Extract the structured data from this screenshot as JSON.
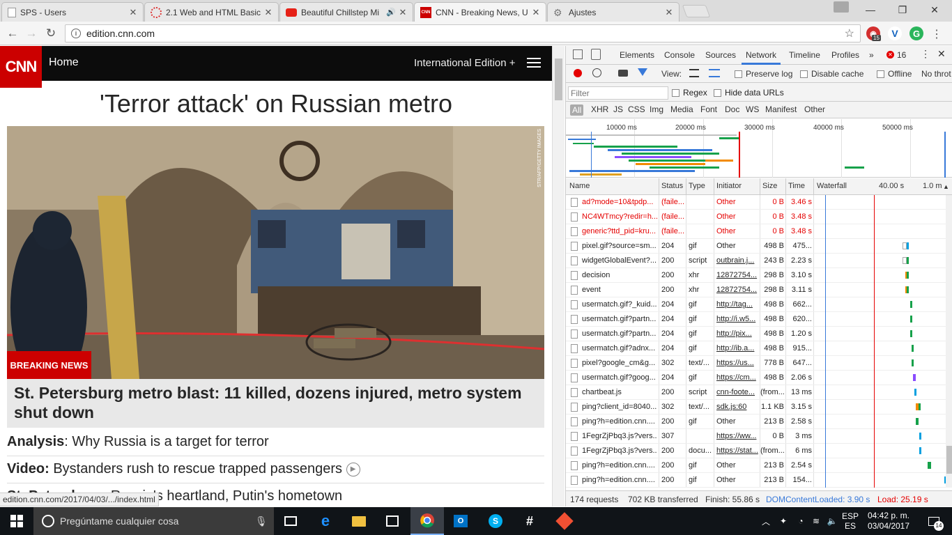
{
  "browser": {
    "tabs": [
      {
        "title": "SPS - Users",
        "favicon": "page-icon"
      },
      {
        "title": "2.1 Web and HTML Basic",
        "favicon": "loading-icon"
      },
      {
        "title": "Beautiful Chillstep Mi",
        "favicon": "youtube-icon"
      },
      {
        "title": "CNN - Breaking News, U",
        "favicon": "cnn-icon"
      },
      {
        "title": "Ajustes",
        "favicon": "gear-icon"
      }
    ],
    "address": "edition.cnn.com",
    "extension_badge": "15",
    "status_url": "edition.cnn.com/2017/04/03/.../index.html"
  },
  "cnn": {
    "logo": "CNN",
    "home": "Home",
    "edition": "International Edition +",
    "headline": "'Terror attack' on Russian metro",
    "photo_credit": "STR/AFP/GETTY IMAGES",
    "breaking": "BREAKING NEWS",
    "main_story": "St. Petersburg metro blast: 11 killed, dozens injured, metro system shut down",
    "stories": [
      {
        "label": "Analysis",
        "sep": ":",
        "text": " Why Russia is a target for terror"
      },
      {
        "label": "Video:",
        "sep": "",
        "text": " Bystanders rush to rescue trapped passengers"
      },
      {
        "label": "St. Petersburg:",
        "sep": "",
        "text": " Russia's heartland, Putin's hometown"
      }
    ]
  },
  "devtools": {
    "tabs": [
      "Elements",
      "Console",
      "Sources",
      "Network",
      "Timeline",
      "Profiles"
    ],
    "more": "»",
    "error_count": "16",
    "controls": {
      "view": "View:",
      "preserve_log": "Preserve log",
      "disable_cache": "Disable cache",
      "offline": "Offline",
      "throttle": "No throt"
    },
    "filter_placeholder": "Filter",
    "regex": "Regex",
    "hide_data_urls": "Hide data URLs",
    "types": [
      "All",
      "XHR",
      "JS",
      "CSS",
      "Img",
      "Media",
      "Font",
      "Doc",
      "WS",
      "Manifest",
      "Other"
    ],
    "overview_labels": [
      "10000 ms",
      "20000 ms",
      "30000 ms",
      "40000 ms",
      "50000 ms"
    ],
    "columns": [
      "Name",
      "Status",
      "Type",
      "Initiator",
      "Size",
      "Time",
      "Waterfall",
      "40.00 s",
      "1.0 m"
    ],
    "rows": [
      {
        "name": "ad?mode=10&tpdp...",
        "status": "(faile...",
        "type": "",
        "initiator": "Other",
        "size": "0 B",
        "time": "3.46 s",
        "error": true,
        "link": false,
        "wf": [],
        "wfc": []
      },
      {
        "name": "NC4WTmcy?redir=h...",
        "status": "(faile...",
        "type": "",
        "initiator": "Other",
        "size": "0 B",
        "time": "3.48 s",
        "error": true,
        "link": false,
        "wf": [],
        "wfc": []
      },
      {
        "name": "generic?ttd_pid=kru...",
        "status": "(faile...",
        "type": "",
        "initiator": "Other",
        "size": "0 B",
        "time": "3.48 s",
        "error": true,
        "link": false,
        "wf": [],
        "wfc": []
      },
      {
        "name": "pixel.gif?source=sm...",
        "status": "204",
        "type": "gif",
        "initiator": "Other",
        "size": "498 B",
        "time": "475...",
        "error": false,
        "link": false,
        "wf": [
          [
            0.67,
            0.03
          ],
          [
            0.7,
            0.01
          ]
        ],
        "wfc": [
          "#ffffff",
          "#00a0e0"
        ]
      },
      {
        "name": "widgetGlobalEvent?...",
        "status": "200",
        "type": "script",
        "initiator": "outbrain.j...",
        "size": "243 B",
        "time": "2.23 s",
        "error": false,
        "link": true,
        "wf": [
          [
            0.67,
            0.03
          ],
          [
            0.7,
            0.02
          ]
        ],
        "wfc": [
          "#ffffff",
          "#16a14a"
        ]
      },
      {
        "name": "decision",
        "status": "200",
        "type": "xhr",
        "initiator": "12872754...",
        "size": "298 B",
        "time": "3.10 s",
        "error": false,
        "link": true,
        "wf": [
          [
            0.69,
            0.01
          ],
          [
            0.7,
            0.02
          ]
        ],
        "wfc": [
          "#f28b00",
          "#16a14a"
        ]
      },
      {
        "name": "event",
        "status": "200",
        "type": "xhr",
        "initiator": "12872754...",
        "size": "298 B",
        "time": "3.11 s",
        "error": false,
        "link": true,
        "wf": [
          [
            0.69,
            0.01
          ],
          [
            0.7,
            0.02
          ]
        ],
        "wfc": [
          "#f28b00",
          "#16a14a"
        ]
      },
      {
        "name": "usermatch.gif?_kuid...",
        "status": "204",
        "type": "gif",
        "initiator": "http://tag...",
        "size": "498 B",
        "time": "662...",
        "error": false,
        "link": true,
        "wf": [
          [
            0.73,
            0.01
          ]
        ],
        "wfc": [
          "#16a14a"
        ]
      },
      {
        "name": "usermatch.gif?partn...",
        "status": "204",
        "type": "gif",
        "initiator": "http://i.w5...",
        "size": "498 B",
        "time": "620...",
        "error": false,
        "link": true,
        "wf": [
          [
            0.73,
            0.01
          ]
        ],
        "wfc": [
          "#16a14a"
        ]
      },
      {
        "name": "usermatch.gif?partn...",
        "status": "204",
        "type": "gif",
        "initiator": "http://pix...",
        "size": "498 B",
        "time": "1.20 s",
        "error": false,
        "link": true,
        "wf": [
          [
            0.73,
            0.01
          ]
        ],
        "wfc": [
          "#16a14a"
        ]
      },
      {
        "name": "usermatch.gif?adnx...",
        "status": "204",
        "type": "gif",
        "initiator": "http://ib.a...",
        "size": "498 B",
        "time": "915...",
        "error": false,
        "link": true,
        "wf": [
          [
            0.74,
            0.01
          ]
        ],
        "wfc": [
          "#16a14a"
        ]
      },
      {
        "name": "pixel?google_cm&g...",
        "status": "302",
        "type": "text/...",
        "initiator": "https://us...",
        "size": "778 B",
        "time": "647...",
        "error": false,
        "link": true,
        "wf": [
          [
            0.74,
            0.01
          ]
        ],
        "wfc": [
          "#16a14a"
        ]
      },
      {
        "name": "usermatch.gif?goog...",
        "status": "204",
        "type": "gif",
        "initiator": "https://cm...",
        "size": "498 B",
        "time": "2.06 s",
        "error": false,
        "link": true,
        "wf": [
          [
            0.75,
            0.02
          ]
        ],
        "wfc": [
          "#8a4cff"
        ]
      },
      {
        "name": "chartbeat.js",
        "status": "200",
        "type": "script",
        "initiator": "cnn-foote...",
        "size": "(from...",
        "time": "13 ms",
        "error": false,
        "link": true,
        "wf": [
          [
            0.76,
            0.005
          ]
        ],
        "wfc": [
          "#00a0e0"
        ]
      },
      {
        "name": "ping?client_id=8040...",
        "status": "302",
        "type": "text/...",
        "initiator": "sdk.js:60",
        "size": "1.1 KB",
        "time": "3.15 s",
        "error": false,
        "link": true,
        "wf": [
          [
            0.77,
            0.02
          ],
          [
            0.79,
            0.01
          ]
        ],
        "wfc": [
          "#f28b00",
          "#16a14a"
        ]
      },
      {
        "name": "ping?h=edition.cnn....",
        "status": "200",
        "type": "gif",
        "initiator": "Other",
        "size": "213 B",
        "time": "2.58 s",
        "error": false,
        "link": false,
        "wf": [
          [
            0.77,
            0.02
          ]
        ],
        "wfc": [
          "#16a14a"
        ]
      },
      {
        "name": "1FegrZjPbq3.js?vers...",
        "status": "307",
        "type": "",
        "initiator": "https://ww...",
        "size": "0 B",
        "time": "3 ms",
        "error": false,
        "link": true,
        "wf": [
          [
            0.8,
            0.005
          ]
        ],
        "wfc": [
          "#00a0e0"
        ]
      },
      {
        "name": "1FegrZjPbq3.js?vers...",
        "status": "200",
        "type": "docu...",
        "initiator": "https://stat...",
        "size": "(from...",
        "time": "6 ms",
        "error": false,
        "link": true,
        "wf": [
          [
            0.8,
            0.005
          ]
        ],
        "wfc": [
          "#00a0e0"
        ]
      },
      {
        "name": "ping?h=edition.cnn....",
        "status": "200",
        "type": "gif",
        "initiator": "Other",
        "size": "213 B",
        "time": "2.54 s",
        "error": false,
        "link": false,
        "wf": [
          [
            0.86,
            0.03
          ]
        ],
        "wfc": [
          "#16a14a"
        ]
      },
      {
        "name": "ping?h=edition.cnn....",
        "status": "200",
        "type": "gif",
        "initiator": "Other",
        "size": "213 B",
        "time": "154...",
        "error": false,
        "link": false,
        "wf": [
          [
            0.99,
            0.005
          ]
        ],
        "wfc": [
          "#00a0e0"
        ]
      }
    ],
    "summary": {
      "requests": "174 requests",
      "transferred": "702 KB transferred",
      "finish": "Finish: 55.86 s",
      "dom": "DOMContentLoaded: 3.90 s",
      "load": "Load: 25.19 s"
    }
  },
  "taskbar": {
    "search_placeholder": "Pregúntame cualquier cosa",
    "lang_top": "ESP",
    "lang_bottom": "ES",
    "time": "04:42 p. m.",
    "date": "03/04/2017",
    "notifications": "14"
  },
  "colors": {
    "cnn_red": "#cc0000",
    "devtools_blue": "#3879d9",
    "error_red": "#e50000"
  }
}
